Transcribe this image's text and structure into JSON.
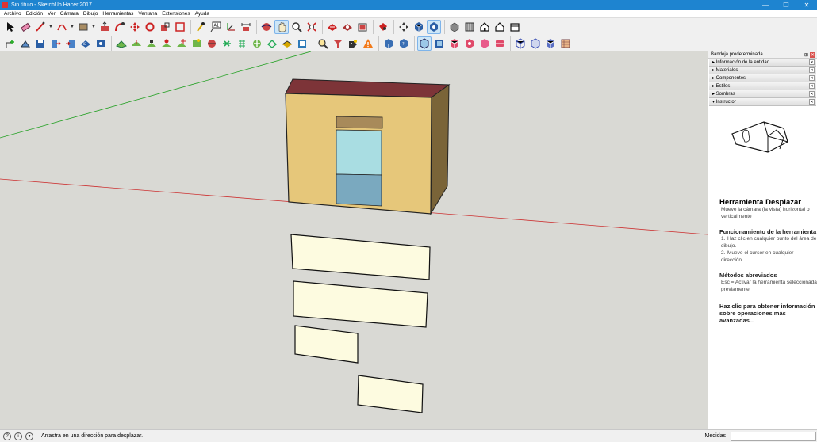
{
  "window": {
    "title": "Sin título - SketchUp Hacer 2017",
    "controls": [
      "—",
      "❐",
      "✕"
    ]
  },
  "menu": [
    "Archivo",
    "Edición",
    "Ver",
    "Cámara",
    "Dibujo",
    "Herramientas",
    "Ventana",
    "Extensiones",
    "Ayuda"
  ],
  "tray": {
    "title": "Bandeja predeterminada",
    "panels": [
      {
        "label": "▸ Información de la entidad"
      },
      {
        "label": "▸ Materiales"
      },
      {
        "label": "▸ Componentes"
      },
      {
        "label": "▸ Estilos"
      },
      {
        "label": "▸ Sombras"
      },
      {
        "label": "▾ Instructor"
      }
    ],
    "instructor": {
      "title": "Herramienta Desplazar",
      "subtitle": "Mueve la cámara (la vista) horizontal o verticalmente",
      "howto_heading": "Funcionamiento de la herramienta",
      "steps": [
        {
          "num": "1.",
          "text": "Haz clic en cualquier punto del área de dibujo."
        },
        {
          "num": "2.",
          "text": "Mueve el cursor en cualquier dirección."
        }
      ],
      "shortcuts_heading": "Métodos abreviados",
      "shortcuts": "Esc = Activar la herramienta seleccionada previamente",
      "more": "Haz clic para obtener información sobre operaciones más avanzadas..."
    }
  },
  "status": {
    "message": "Arrastra en una dirección para desplazar.",
    "measure_label": "Medidas",
    "measure_value": ""
  },
  "colors": {
    "titlebar": "#1e84d0",
    "viewport_bg": "#d9d9d4",
    "wall_front": "#e6c77a",
    "wall_side": "#7a6438",
    "roof": "#7d3438",
    "glass_top": "#a9dde2",
    "glass_bottom": "#7aa9bf",
    "panel_fill": "#fdfbe0"
  }
}
